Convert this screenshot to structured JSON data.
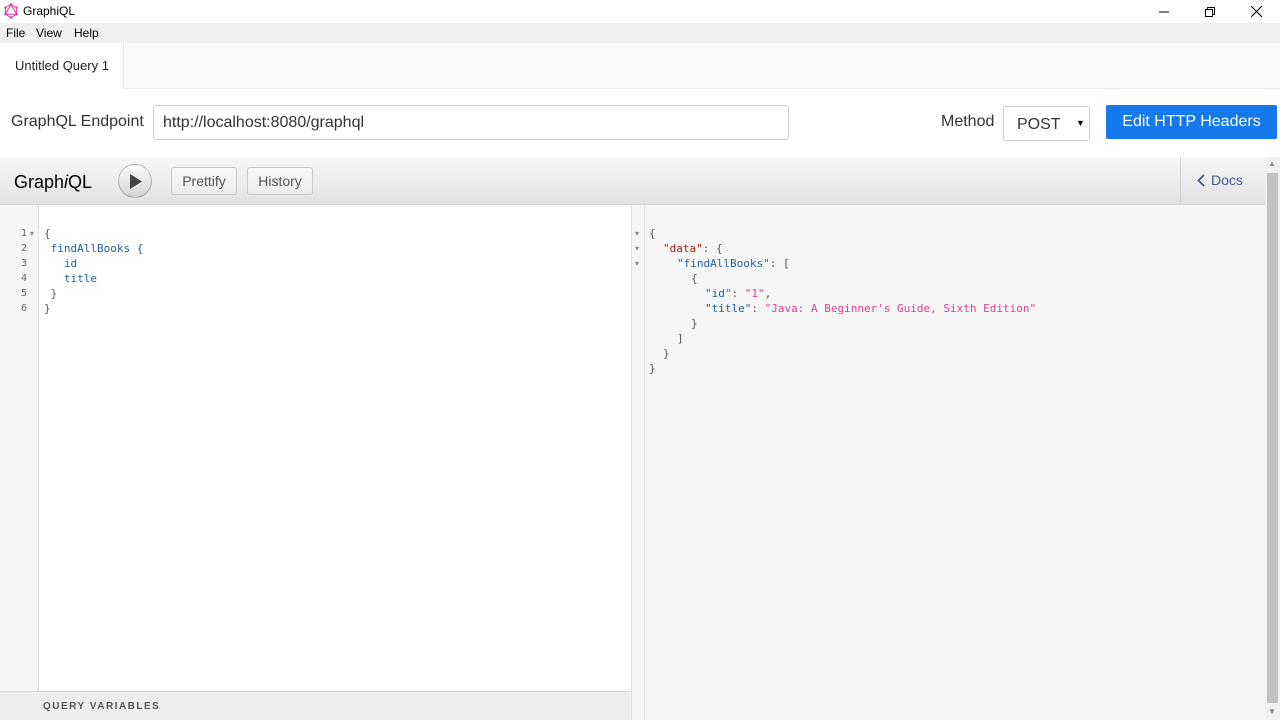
{
  "window": {
    "title": "GraphiQL",
    "icon": "graphql-logo-icon",
    "accent": "#e535ab"
  },
  "menu": {
    "items": [
      "File",
      "View",
      "Help"
    ]
  },
  "tabs": [
    {
      "label": "Untitled Query 1",
      "active": true
    }
  ],
  "endpoint": {
    "label": "GraphQL Endpoint",
    "value": "http://localhost:8080/graphql",
    "method_label": "Method",
    "method_value": "POST",
    "edit_headers_label": "Edit HTTP Headers",
    "button_color": "#1479eb"
  },
  "toolbar": {
    "logo_pre": "Graph",
    "logo_i": "i",
    "logo_post": "QL",
    "prettify_label": "Prettify",
    "history_label": "History",
    "docs_label": "Docs"
  },
  "query_editor": {
    "line_numbers": [
      "1",
      "2",
      "3",
      "4",
      "5",
      "6"
    ],
    "lines": [
      "{",
      " findAllBooks {",
      "   id",
      "   title",
      " }",
      "}"
    ]
  },
  "query_variables_label": "QUERY VARIABLES",
  "result": {
    "lines": [
      "{",
      "  \"data\": {",
      "    \"findAllBooks\": [",
      "      {",
      "        \"id\": \"1\",",
      "        \"title\": \"Java: A Beginner's Guide, Sixth Edition\"",
      "      }",
      "    ]",
      "  }",
      "}"
    ],
    "data_key": "\"data\"",
    "list_key": "\"findAllBooks\"",
    "id_key": "\"id\"",
    "id_value": "\"1\"",
    "title_key": "\"title\"",
    "title_value": "\"Java: A Beginner's Guide, Sixth Edition\""
  }
}
